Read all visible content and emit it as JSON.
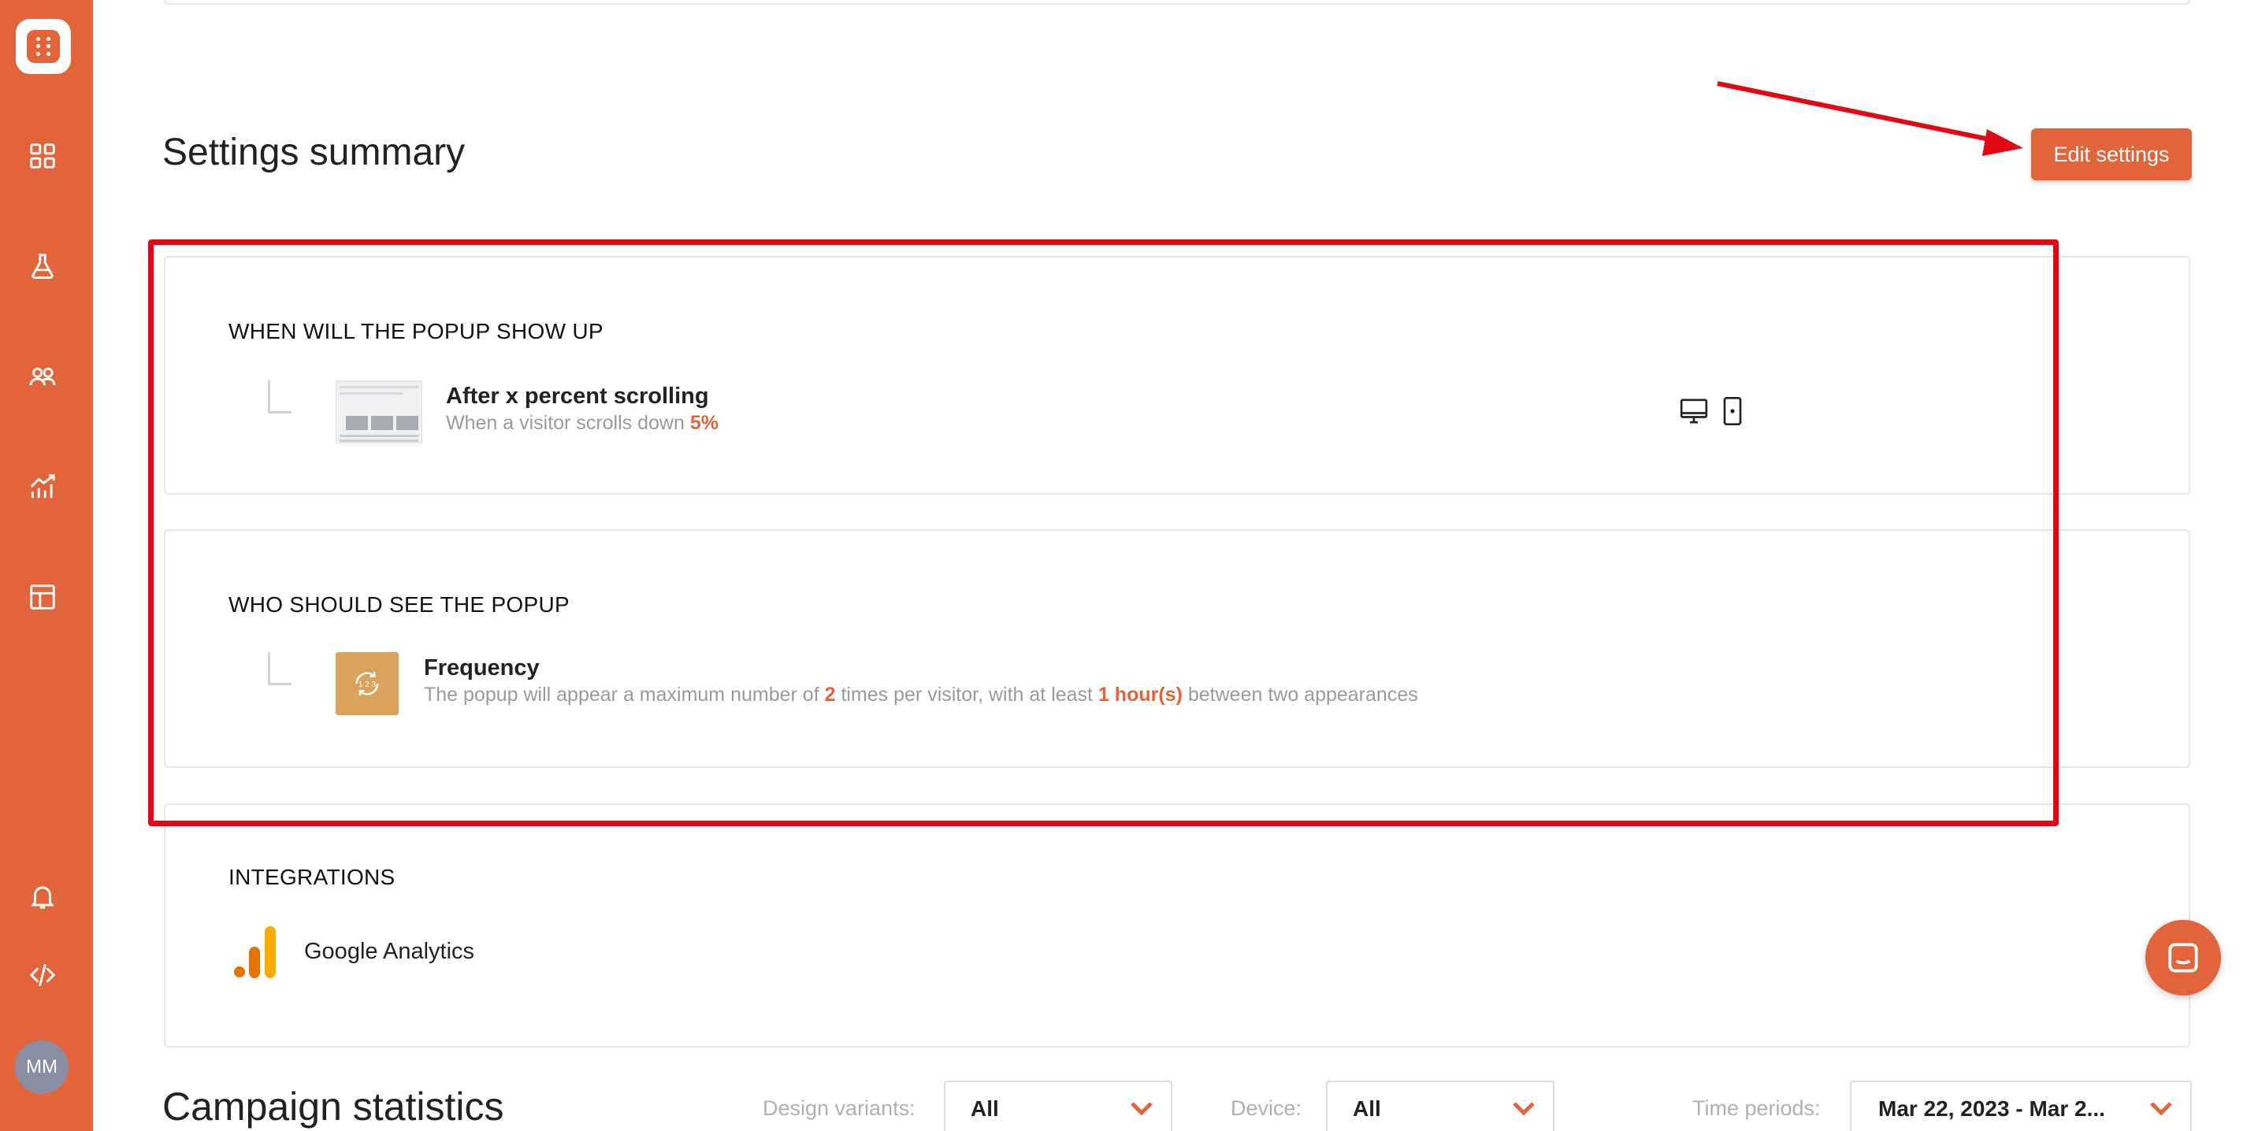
{
  "sidebar": {
    "items": [
      {
        "icon": "dashboard-icon"
      },
      {
        "icon": "flask-icon"
      },
      {
        "icon": "users-icon"
      },
      {
        "icon": "analytics-icon"
      },
      {
        "icon": "layout-icon"
      },
      {
        "icon": "bell-icon"
      },
      {
        "icon": "code-icon"
      }
    ],
    "avatar_initials": "MM"
  },
  "header": {
    "title": "Settings summary",
    "edit_button": "Edit settings"
  },
  "sections": {
    "when": {
      "heading": "WHEN WILL THE POPUP SHOW UP",
      "item_title": "After x percent scrolling",
      "item_desc": "When a visitor scrolls down ",
      "item_value": "5%"
    },
    "who": {
      "heading": "WHO SHOULD SEE THE POPUP",
      "item_title": "Frequency",
      "desc_part1": "The popup will appear a maximum number of ",
      "max_times": "2",
      "desc_part2": " times per visitor, with at least ",
      "interval": "1 hour(s)",
      "desc_part3": " between two appearances"
    },
    "integrations": {
      "heading": "INTEGRATIONS",
      "item": "Google Analytics"
    }
  },
  "stats": {
    "title": "Campaign statistics",
    "filters": {
      "design_label": "Design variants:",
      "design_value": "All",
      "device_label": "Device:",
      "device_value": "All",
      "time_label": "Time periods:",
      "time_value": "Mar 22, 2023 - Mar 2..."
    }
  },
  "colors": {
    "brand": "#e2643b",
    "annotation": "#e30613",
    "frequency_tile": "#dba25d"
  }
}
